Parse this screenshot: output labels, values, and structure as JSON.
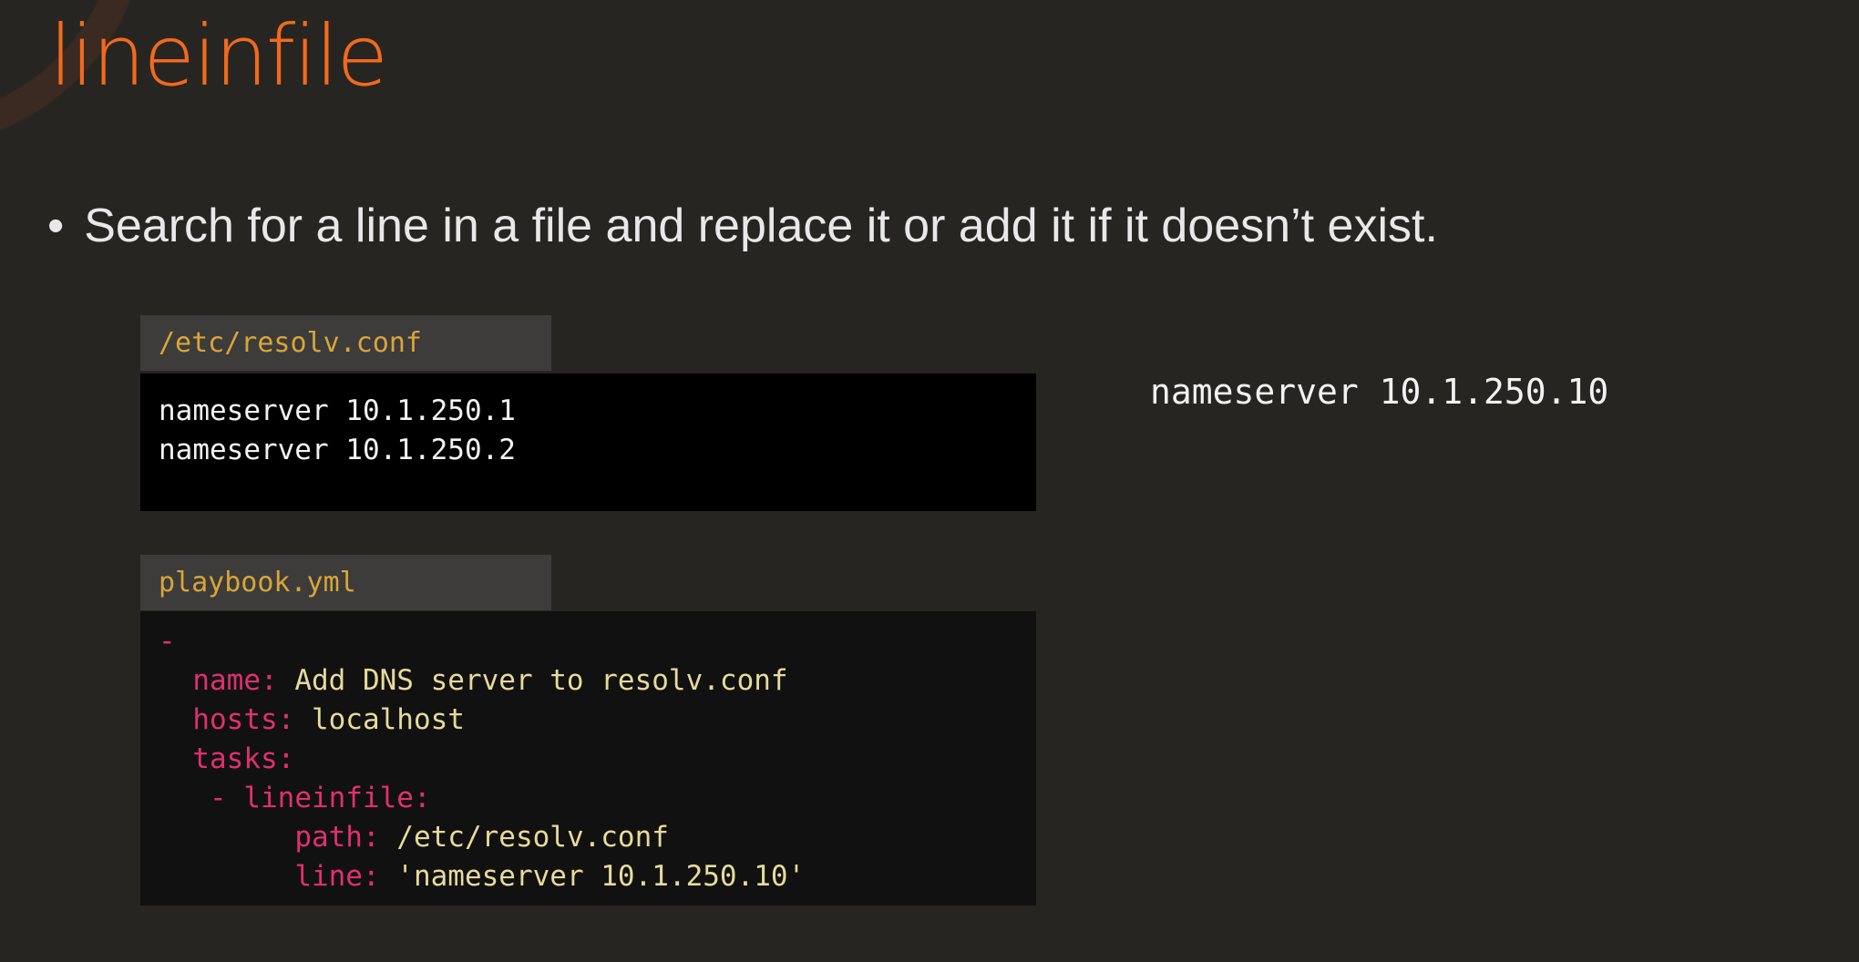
{
  "title": "lineinfile",
  "bullet": "Search for a line in a file and replace it or add it if it doesn’t exist.",
  "file1": {
    "name": "/etc/resolv.conf",
    "lines": [
      "nameserver 10.1.250.1",
      "nameserver 10.1.250.2"
    ]
  },
  "file2": {
    "name": "playbook.yml",
    "lines": [
      {
        "indent": "",
        "key": "-",
        "value": ""
      },
      {
        "indent": "  ",
        "key": "name:",
        "value": " Add DNS server to resolv.conf"
      },
      {
        "indent": "  ",
        "key": "hosts:",
        "value": " localhost"
      },
      {
        "indent": "  ",
        "key": "tasks:",
        "value": ""
      },
      {
        "indent": "   ",
        "key": "- lineinfile:",
        "value": ""
      },
      {
        "indent": "        ",
        "key": "path:",
        "value": " /etc/resolv.conf"
      },
      {
        "indent": "        ",
        "key": "line:",
        "value": " 'nameserver 10.1.250.10'"
      }
    ]
  },
  "new_line": "nameserver 10.1.250.10",
  "colors": {
    "title": "#f26a1b",
    "key": "#e0306e",
    "value": "#e6db9a",
    "header": "#d9a53a"
  }
}
